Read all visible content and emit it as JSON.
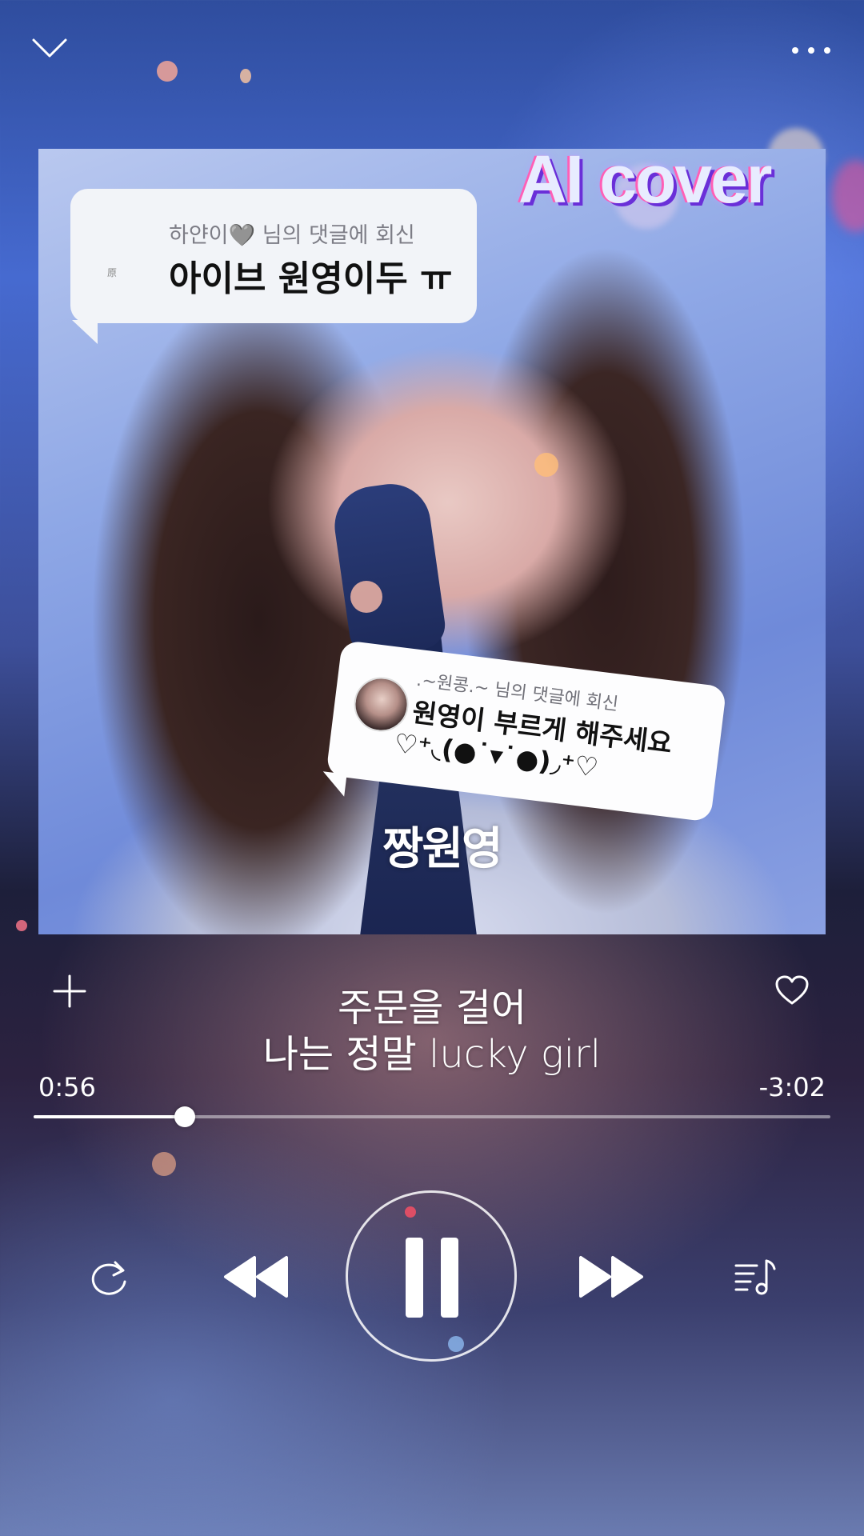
{
  "artwork": {
    "overlay_title": "AI cover",
    "watermark": "짱원영"
  },
  "comments": [
    {
      "reply_to": "하얀이🩶 님의 댓글에 회신",
      "avatar_text": "原",
      "text": "아이브 원영이두 ㅠ"
    },
    {
      "reply_to": ".~원콩.~ 님의 댓글에 회신",
      "text_line1": "원영이 부르게 해주세요",
      "text_line2": "♡⁺◟(●˙▾˙●)◞⁺♡"
    }
  ],
  "lyrics": {
    "line1": "주문을 걸어",
    "line2": "나는 정말 lucky girl"
  },
  "playback": {
    "elapsed": "0:56",
    "remaining": "-3:02",
    "progress_fraction": 0.19,
    "state": "playing"
  },
  "icons": {
    "top_left": "chevron-down-icon",
    "top_right": "more-icon",
    "add": "plus-icon",
    "like": "heart-icon",
    "repeat": "repeat-icon",
    "previous": "rewind-icon",
    "play_pause": "pause-icon",
    "next": "fast-forward-icon",
    "queue": "playlist-icon"
  },
  "colors": {
    "accent": "#ffffff",
    "ai_cover_shadow": "#6a2fd8",
    "ai_cover_glow": "#ff5fb6"
  }
}
